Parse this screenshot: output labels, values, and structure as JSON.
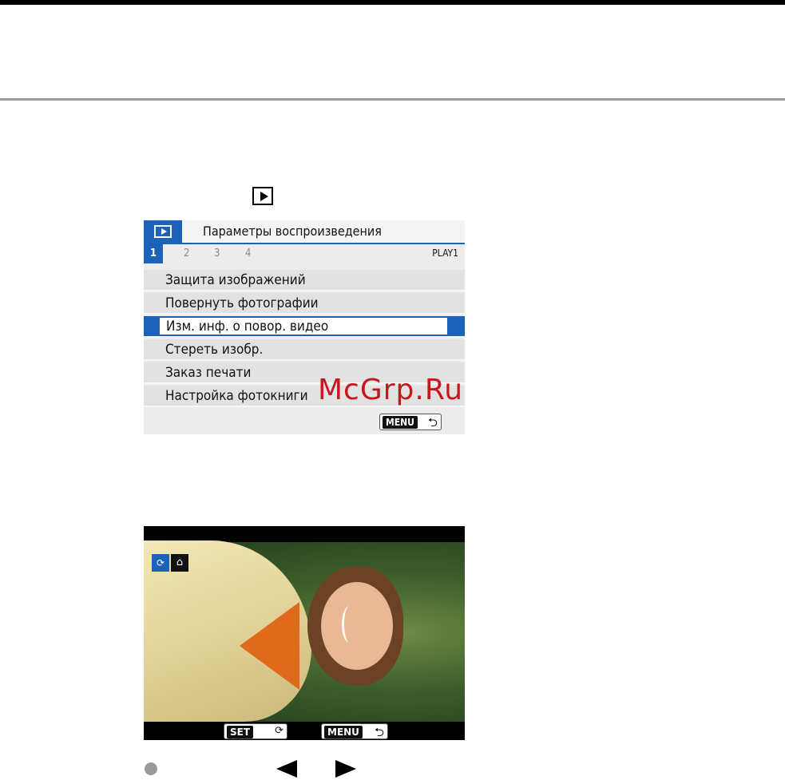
{
  "menu": {
    "title": "Параметры воспроизведения",
    "tabs": [
      "1",
      "2",
      "3",
      "4"
    ],
    "page_label": "PLAY1",
    "items": [
      {
        "label": "Защита изображений"
      },
      {
        "label": "Повернуть фотографии"
      },
      {
        "label": "Изм. инф. о повор. видео",
        "selected": true
      },
      {
        "label": "Стереть изобр."
      },
      {
        "label": "Заказ печати"
      },
      {
        "label": "Настройка фотокниги"
      }
    ],
    "menu_button": "MENU",
    "return_glyph": "⮌"
  },
  "watermark": "McGrp.Ru",
  "photo_screen": {
    "set_button": "SET",
    "set_icon": "rotate-icon",
    "menu_button": "MENU",
    "return_glyph": "⮌",
    "icons": [
      "rotate-icon",
      "up-icon"
    ]
  },
  "colors": {
    "menu_accent": "#1b62b8",
    "watermark": "#c8161d"
  }
}
